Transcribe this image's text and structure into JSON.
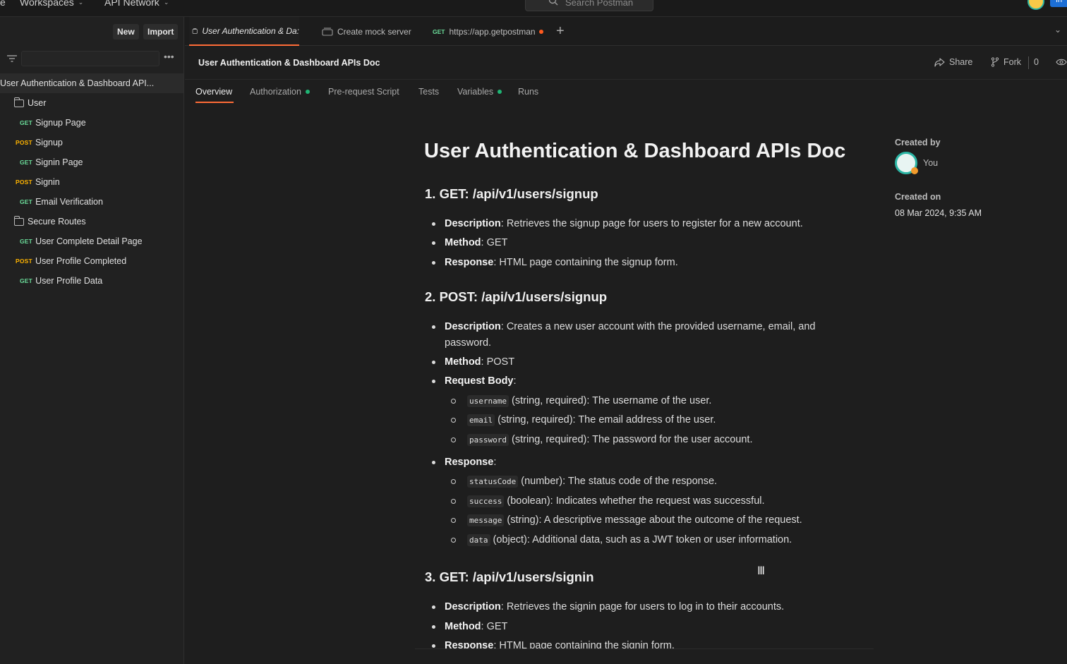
{
  "topbar": {
    "home_fragment": "e",
    "workspaces": "Workspaces",
    "api_network": "API Network",
    "search_placeholder": "Search Postman",
    "invite": "In"
  },
  "sidebar": {
    "new_button": "New",
    "import_button": "Import",
    "more": "•••",
    "root": "User Authentication & Dashboard API...",
    "items": [
      {
        "type": "folder",
        "label": "User"
      },
      {
        "type": "request",
        "method": "GET",
        "label": "Signup Page"
      },
      {
        "type": "request",
        "method": "POST",
        "label": "Signup"
      },
      {
        "type": "request",
        "method": "GET",
        "label": "Signin Page"
      },
      {
        "type": "request",
        "method": "POST",
        "label": "Signin"
      },
      {
        "type": "request",
        "method": "GET",
        "label": "Email Verification"
      },
      {
        "type": "folder",
        "label": "Secure Routes"
      },
      {
        "type": "request",
        "method": "GET",
        "label": "User Complete Detail Page"
      },
      {
        "type": "request",
        "method": "POST",
        "label": "User Profile Completed"
      },
      {
        "type": "request",
        "method": "GET",
        "label": "User Profile Data"
      }
    ]
  },
  "tabs": [
    {
      "label": "User Authentication & Da:",
      "active": true
    },
    {
      "label": "Create mock server",
      "active": false
    },
    {
      "method": "GET",
      "label": "https://app.getpostman",
      "active": false,
      "unsaved": true
    }
  ],
  "collection": {
    "title": "User Authentication & Dashboard APIs Doc",
    "share": "Share",
    "fork": "Fork",
    "fork_count": "0"
  },
  "subtabs": [
    {
      "label": "Overview",
      "active": true,
      "dot": false
    },
    {
      "label": "Authorization",
      "active": false,
      "dot": true
    },
    {
      "label": "Pre-request Script",
      "active": false,
      "dot": false
    },
    {
      "label": "Tests",
      "active": false,
      "dot": false
    },
    {
      "label": "Variables",
      "active": false,
      "dot": true
    },
    {
      "label": "Runs",
      "active": false,
      "dot": false
    }
  ],
  "doc": {
    "title": "User Authentication & Dashboard APIs Doc",
    "sections": [
      {
        "heading": "1. GET: /api/v1/users/signup",
        "description": "Retrieves the signup page for users to register for a new account.",
        "method": "GET",
        "response": "HTML page containing the signup form."
      },
      {
        "heading": "2. POST: /api/v1/users/signup",
        "description": "Creates a new user account with the provided username, email, and password.",
        "method": "POST",
        "request_body": [
          {
            "field": "username",
            "text": "(string, required): The username of the user."
          },
          {
            "field": "email",
            "text": "(string, required): The email address of the user."
          },
          {
            "field": "password",
            "text": "(string, required): The password for the user account."
          }
        ],
        "response": [
          {
            "field": "statusCode",
            "text": "(number): The status code of the response."
          },
          {
            "field": "success",
            "text": "(boolean): Indicates whether the request was successful."
          },
          {
            "field": "message",
            "text": "(string): A descriptive message about the outcome of the request."
          },
          {
            "field": "data",
            "text": "(object): Additional data, such as a JWT token or user information."
          }
        ]
      },
      {
        "heading": "3. GET: /api/v1/users/signin",
        "description": "Retrieves the signin page for users to log in to their accounts.",
        "method": "GET",
        "response": "HTML page containing the signin form."
      }
    ],
    "labels": {
      "description": "Description",
      "method": "Method",
      "request_body": "Request Body",
      "response": "Response"
    }
  },
  "meta": {
    "created_by_label": "Created by",
    "created_by": "You",
    "created_on_label": "Created on",
    "created_on": "08 Mar 2024, 9:35 AM"
  },
  "colors": {
    "accent": "#ff6c37",
    "get": "#6bdd9a",
    "post": "#ffb400",
    "status_green": "#1fb574"
  }
}
